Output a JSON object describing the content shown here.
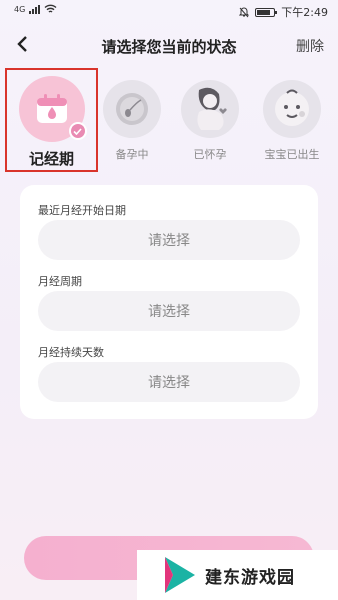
{
  "status_bar": {
    "network": "4G",
    "time": "下午2:49"
  },
  "header": {
    "title": "请选择您当前的状态",
    "delete_label": "删除"
  },
  "states": [
    {
      "label": "记经期",
      "icon": "calendar-drop-icon",
      "active": true
    },
    {
      "label": "备孕中",
      "icon": "sperm-egg-icon",
      "active": false
    },
    {
      "label": "已怀孕",
      "icon": "pregnant-woman-icon",
      "active": false
    },
    {
      "label": "宝宝已出生",
      "icon": "baby-icon",
      "active": false
    }
  ],
  "form": {
    "fields": [
      {
        "label": "最近月经开始日期",
        "value": "请选择"
      },
      {
        "label": "月经周期",
        "value": "请选择"
      },
      {
        "label": "月经持续天数",
        "value": "请选择"
      }
    ]
  },
  "watermark": {
    "text": "建东游戏园"
  },
  "colors": {
    "accent": "#f5b0cf",
    "highlight_border": "#d9342b",
    "check": "#e98bb3"
  }
}
